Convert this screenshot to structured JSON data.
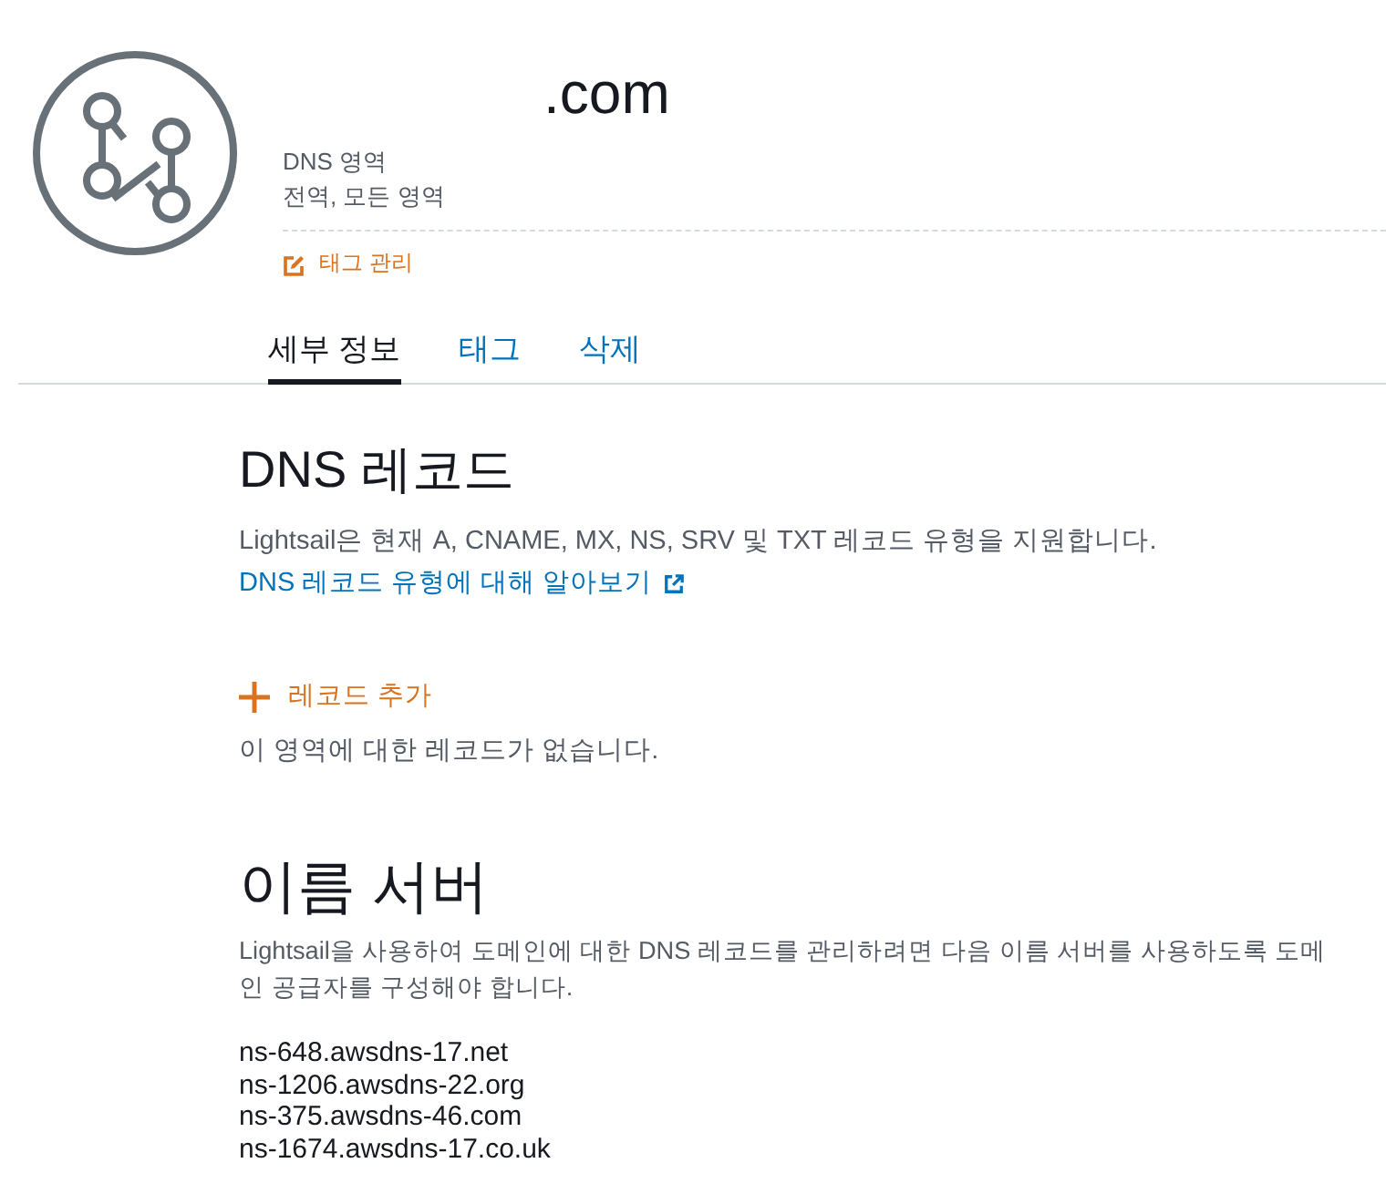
{
  "header": {
    "title": ".com",
    "zone_type": "DNS 영역",
    "scope": "전역, 모든 영역",
    "manage_tags": "태그 관리"
  },
  "tabs": [
    {
      "label": "세부 정보",
      "selected": true
    },
    {
      "label": "태그",
      "selected": false
    },
    {
      "label": "삭제",
      "selected": false
    }
  ],
  "dns_records": {
    "heading": "DNS 레코드",
    "description": "Lightsail은 현재 A, CNAME, MX, NS, SRV 및 TXT 레코드 유형을 지원합니다.",
    "learn_more": "DNS 레코드 유형에 대해 알아보기",
    "add_record": "레코드 추가",
    "empty_message": "이 영역에 대한 레코드가 없습니다."
  },
  "name_servers": {
    "heading": "이름 서버",
    "description": "Lightsail을 사용하여 도메인에 대한 DNS 레코드를 관리하려면 다음 이름 서버를 사용하도록 도메인 공급자를 구성해야 합니다.",
    "servers": [
      "ns-648.awsdns-17.net",
      "ns-1206.awsdns-22.org",
      "ns-375.awsdns-46.com",
      "ns-1674.awsdns-17.co.uk"
    ]
  }
}
